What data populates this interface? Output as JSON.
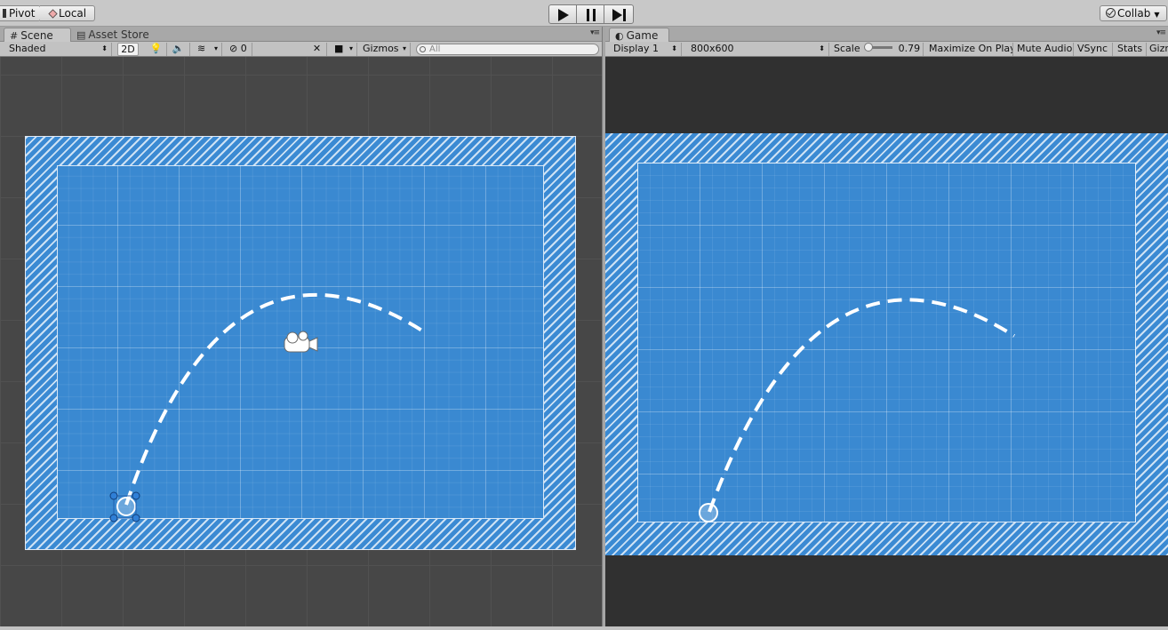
{
  "toolbar": {
    "pivot_label": "Pivot",
    "local_label": "Local",
    "collab_label": "Collab"
  },
  "scene_panel": {
    "tabs": [
      {
        "label": "Scene",
        "active": true,
        "icon": "grid-icon"
      },
      {
        "label": "Asset Store",
        "active": false,
        "icon": "shopping-bag-icon"
      }
    ],
    "draw_mode": "Shaded",
    "mode_2d": "2D",
    "hidden_layers_count": "0",
    "gizmos_label": "Gizmos",
    "search_placeholder": "All"
  },
  "game_panel": {
    "tab_label": "Game",
    "display": "Display 1",
    "resolution": "800x600",
    "scale_label": "Scale",
    "scale_value": "0.79",
    "maximize_on_play": "Maximize On Play",
    "mute_audio": "Mute Audio",
    "vsync": "VSync",
    "stats": "Stats",
    "gizmos": "Gizm"
  },
  "colors": {
    "field_blue": "#3b8ad3",
    "scene_background": "#474747",
    "game_background": "#303030",
    "trajectory": "#ffffff"
  }
}
